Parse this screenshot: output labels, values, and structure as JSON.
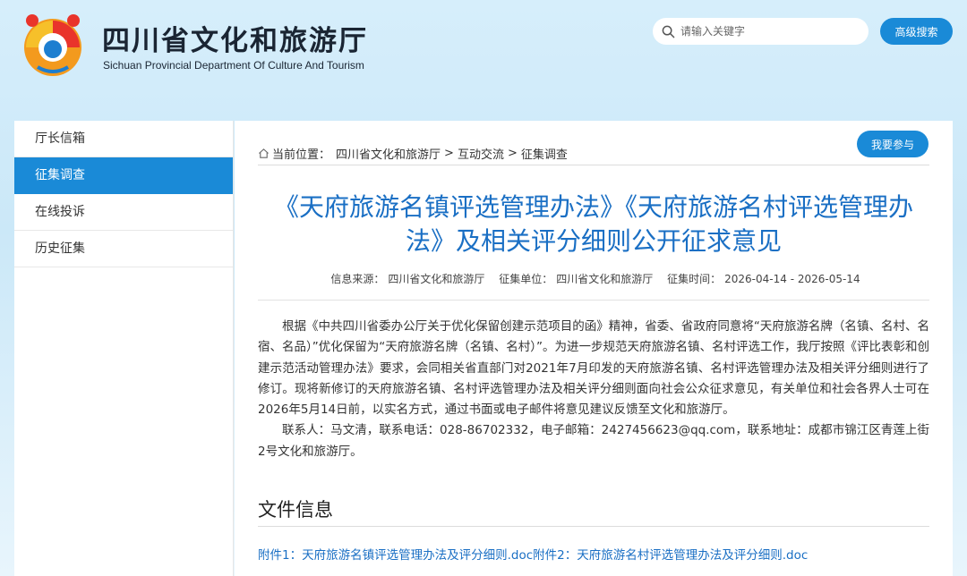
{
  "header": {
    "site_name_cn": "四川省文化和旅游厅",
    "site_name_en": "Sichuan Provincial Department Of Culture And Tourism",
    "search": {
      "placeholder": "请输入关键字"
    },
    "advanced_search_label": "高级搜索"
  },
  "sidebar": {
    "items": [
      {
        "label": "厅长信箱",
        "active": false
      },
      {
        "label": "征集调查",
        "active": true
      },
      {
        "label": "在线投诉",
        "active": false
      },
      {
        "label": "历史征集",
        "active": false
      }
    ]
  },
  "breadcrumb": {
    "prefix": "当前位置：",
    "items": [
      "四川省文化和旅游厅",
      "互动交流",
      "征集调查"
    ],
    "separator": ">"
  },
  "join_button_label": "我要参与",
  "article": {
    "title": "《天府旅游名镇评选管理办法》《天府旅游名村评选管理办法》及相关评分细则公开征求意见",
    "meta": {
      "source_label": "信息来源：",
      "source": "四川省文化和旅游厅",
      "unit_label": "征集单位：",
      "unit": "四川省文化和旅游厅",
      "time_label": "征集时间：",
      "time": "2026-04-14 - 2026-05-14"
    },
    "paragraphs": [
      "根据《中共四川省委办公厅关于优化保留创建示范项目的函》精神，省委、省政府同意将“天府旅游名牌（名镇、名村、名宿、名品）”优化保留为“天府旅游名牌（名镇、名村）”。为进一步规范天府旅游名镇、名村评选工作，我厅按照《评比表彰和创建示范活动管理办法》要求，会同相关省直部门对2021年7月印发的天府旅游名镇、名村评选管理办法及相关评分细则进行了修订。现将新修订的天府旅游名镇、名村评选管理办法及相关评分细则面向社会公众征求意见，有关单位和社会各界人士可在2026年5月14日前，以实名方式，通过书面或电子邮件将意见建议反馈至文化和旅游厅。",
      "联系人：马文清，联系电话：028-86702332，电子邮箱：2427456623@qq.com，联系地址：成都市锦江区青莲上街2号文化和旅游厅。"
    ],
    "file_section_title": "文件信息",
    "attachments": [
      "附件1：天府旅游名镇评选管理办法及评分细则.doc",
      "附件2：天府旅游名村评选管理办法及评分细则.doc"
    ]
  },
  "colors": {
    "accent": "#1a8ad7",
    "title": "#1a6fc4"
  }
}
